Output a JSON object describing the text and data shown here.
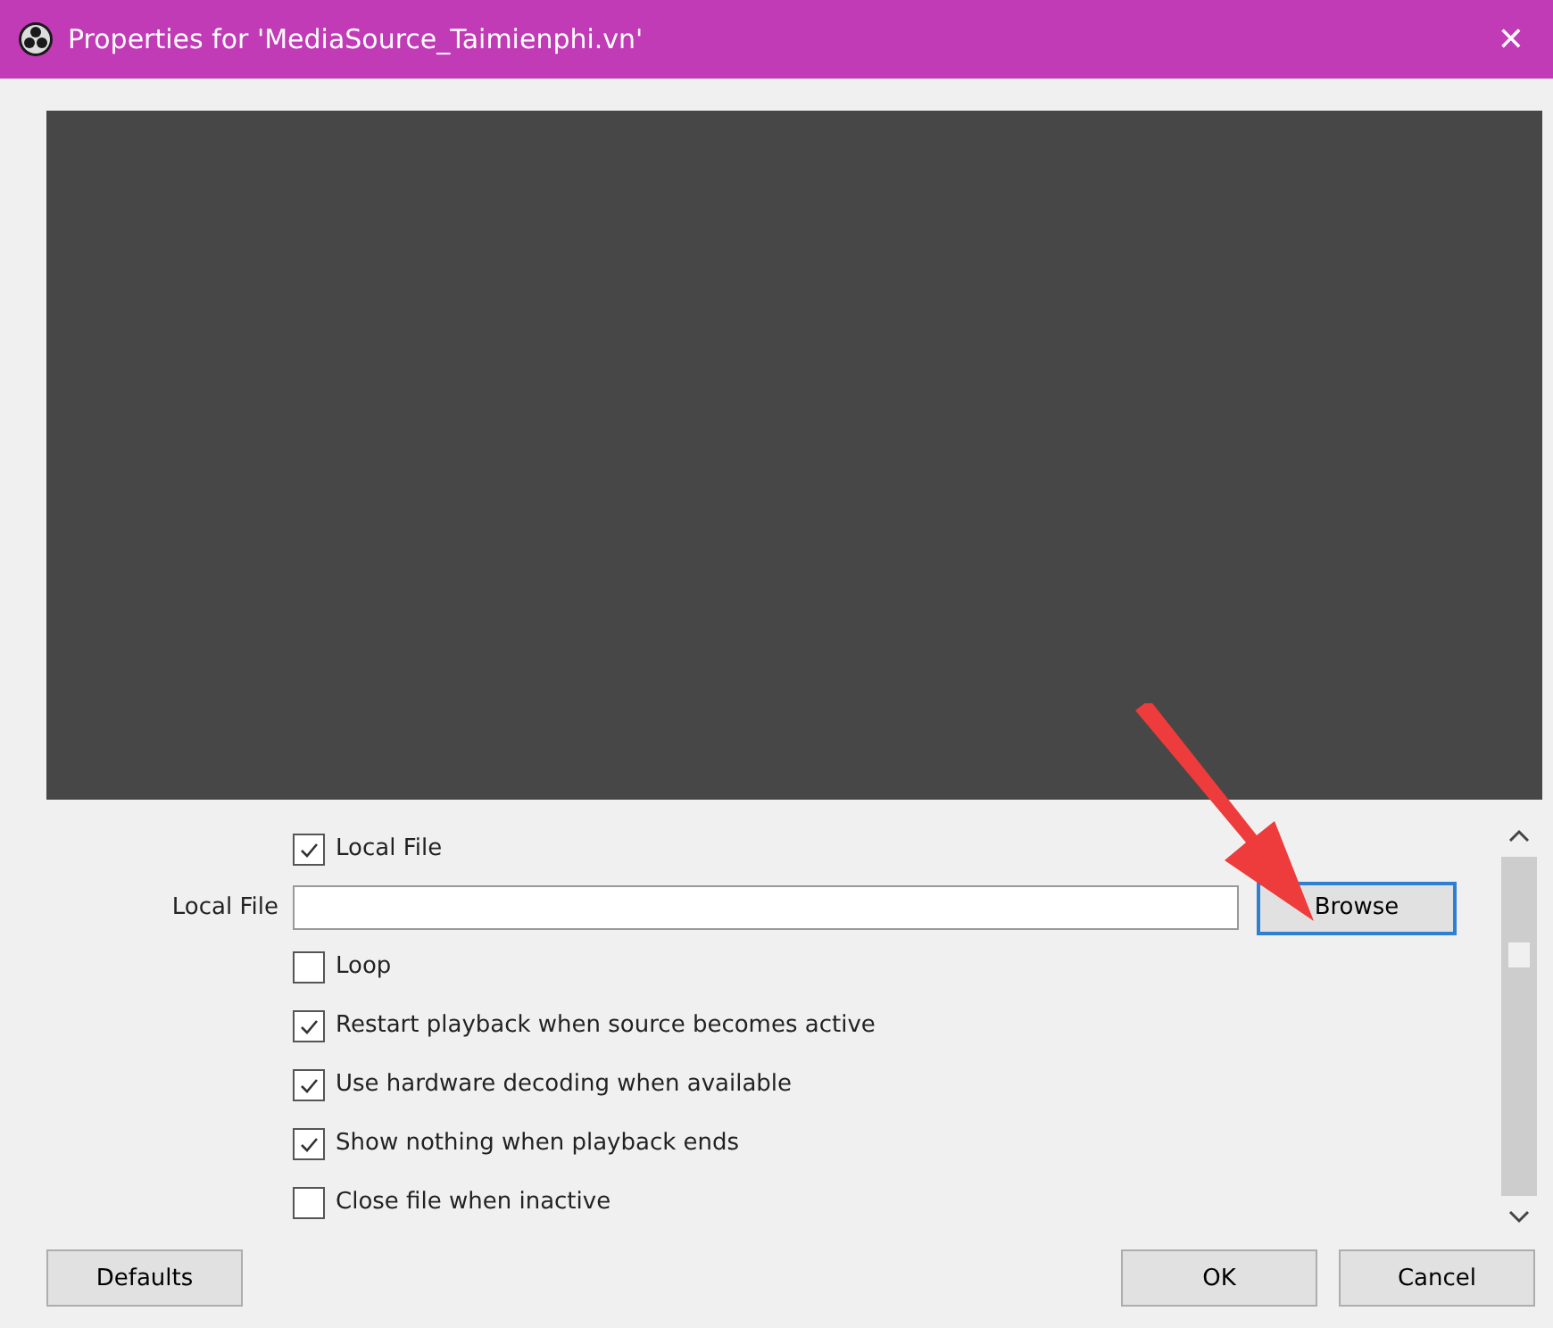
{
  "window": {
    "title": "Properties for 'MediaSource_Taimienphi.vn'",
    "close": "✕"
  },
  "preview": {
    "kind": "video"
  },
  "properties": [
    {
      "kind": "checkbox",
      "label": "Local File",
      "checked": true
    },
    {
      "kind": "file",
      "label": "Local File",
      "button": "Browse"
    },
    {
      "kind": "checkbox",
      "label": "Loop",
      "checked": false
    },
    {
      "kind": "checkbox",
      "label": "Restart playback when source becomes active",
      "checked": true
    },
    {
      "kind": "checkbox",
      "label": "Use hardware decoding when available",
      "checked": true
    },
    {
      "kind": "checkbox",
      "label": "Show nothing when playback ends",
      "checked": true
    },
    {
      "kind": "checkbox",
      "label": "Close file when inactive",
      "checked": false
    }
  ],
  "buttons": {
    "left": "Defaults",
    "ok": "OK",
    "cancel": "Cancel"
  }
}
